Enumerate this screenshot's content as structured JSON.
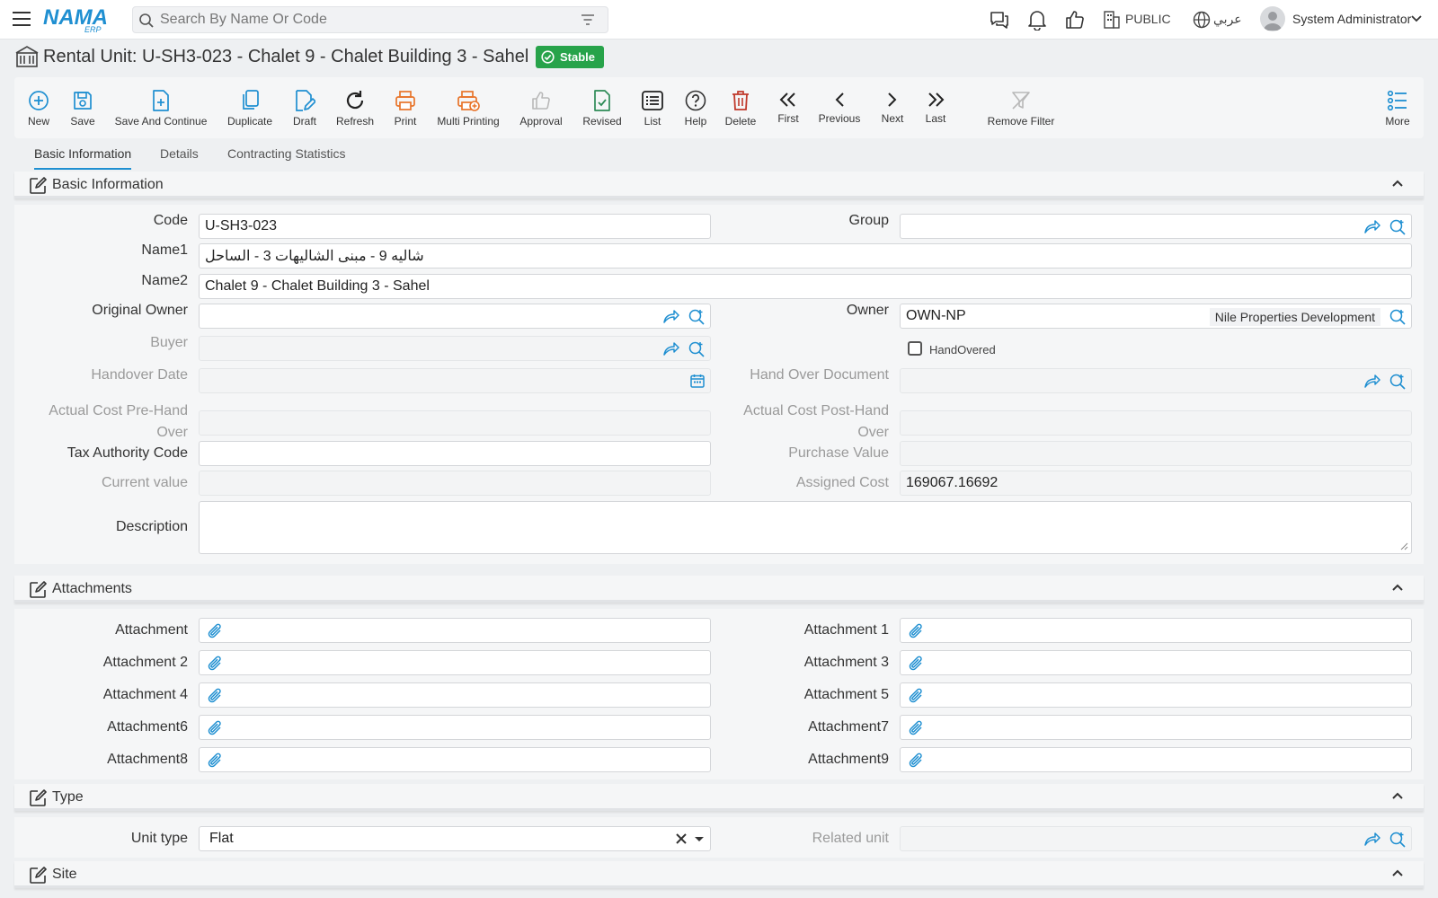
{
  "topbar": {
    "logo_text": "NAMA",
    "logo_sub": "ERP",
    "search_placeholder": "Search By Name Or Code",
    "branch": "PUBLIC",
    "language": "عربي",
    "user_name": "System Administrator"
  },
  "page": {
    "title": "Rental Unit: U-SH3-023 - Chalet 9 - Chalet Building 3 - Sahel",
    "status": "Stable"
  },
  "toolbar": {
    "new": "New",
    "save": "Save",
    "save_continue": "Save And Continue",
    "duplicate": "Duplicate",
    "draft": "Draft",
    "refresh": "Refresh",
    "print": "Print",
    "multi_printing": "Multi Printing",
    "approval": "Approval",
    "revised": "Revised",
    "list": "List",
    "help": "Help",
    "delete": "Delete",
    "first": "First",
    "previous": "Previous",
    "next": "Next",
    "last": "Last",
    "remove_filter": "Remove Filter",
    "more": "More"
  },
  "tabs": [
    "Basic Information",
    "Details",
    "Contracting Statistics"
  ],
  "sections": {
    "basic": "Basic Information",
    "attachments": "Attachments",
    "type": "Type",
    "site": "Site"
  },
  "basic": {
    "code_label": "Code",
    "code_value": "U-SH3-023",
    "group_label": "Group",
    "name1_label": "Name1",
    "name1_value": "شاليه 9 - مبنى الشاليهات 3 - الساحل",
    "name2_label": "Name2",
    "name2_value": "Chalet 9 - Chalet Building 3 - Sahel",
    "original_owner_label": "Original Owner",
    "owner_label": "Owner",
    "owner_value": "OWN-NP",
    "owner_name": "Nile Properties Development",
    "buyer_label": "Buyer",
    "handovered_label": "HandOvered",
    "handover_date_label": "Handover Date",
    "handover_doc_label": "Hand Over Document",
    "cost_pre_label": "Actual Cost Pre-Hand Over",
    "cost_post_label": "Actual Cost Post-Hand Over",
    "tax_label": "Tax Authority Code",
    "purchase_label": "Purchase Value",
    "current_label": "Current value",
    "assigned_label": "Assigned Cost",
    "assigned_value": "169067.16692",
    "description_label": "Description"
  },
  "attachments": [
    "Attachment",
    "Attachment 1",
    "Attachment 2",
    "Attachment 3",
    "Attachment 4",
    "Attachment 5",
    "Attachment6",
    "Attachment7",
    "Attachment8",
    "Attachment9"
  ],
  "type": {
    "unit_type_label": "Unit type",
    "unit_type_value": "Flat",
    "related_label": "Related unit"
  },
  "colors": {
    "accent": "#1f8fd1",
    "stable": "#27a34a",
    "print": "#e8742a",
    "delete": "#c0392b",
    "revised": "#2e8b57"
  }
}
